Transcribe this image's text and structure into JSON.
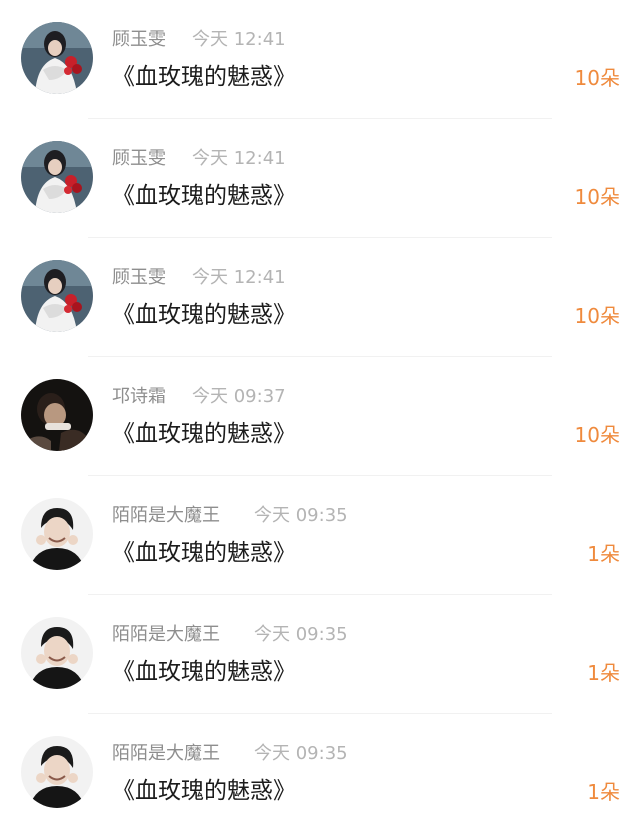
{
  "colors": {
    "accent": "#ef8a3d",
    "name_text": "#8e8e8e",
    "time_text": "#b4b4b4",
    "title_text": "#1c1c1c"
  },
  "gifts": [
    {
      "name": "顾玉雯",
      "time": "今天 12:41",
      "title": "《血玫瑰的魅惑》",
      "count": "10朵",
      "avatar": "avatar-woman-roses"
    },
    {
      "name": "顾玉雯",
      "time": "今天 12:41",
      "title": "《血玫瑰的魅惑》",
      "count": "10朵",
      "avatar": "avatar-woman-roses"
    },
    {
      "name": "顾玉雯",
      "time": "今天 12:41",
      "title": "《血玫瑰的魅惑》",
      "count": "10朵",
      "avatar": "avatar-woman-roses"
    },
    {
      "name": "邛诗霜",
      "time": "今天 09:37",
      "title": "《血玫瑰的魅惑》",
      "count": "10朵",
      "avatar": "avatar-dark-portrait"
    },
    {
      "name": "陌陌是大魔王",
      "time": "今天 09:35",
      "title": "《血玫瑰的魅惑》",
      "count": "1朵",
      "avatar": "avatar-smiling-man"
    },
    {
      "name": "陌陌是大魔王",
      "time": "今天 09:35",
      "title": "《血玫瑰的魅惑》",
      "count": "1朵",
      "avatar": "avatar-smiling-man"
    },
    {
      "name": "陌陌是大魔王",
      "time": "今天 09:35",
      "title": "《血玫瑰的魅惑》",
      "count": "1朵",
      "avatar": "avatar-smiling-man"
    }
  ]
}
